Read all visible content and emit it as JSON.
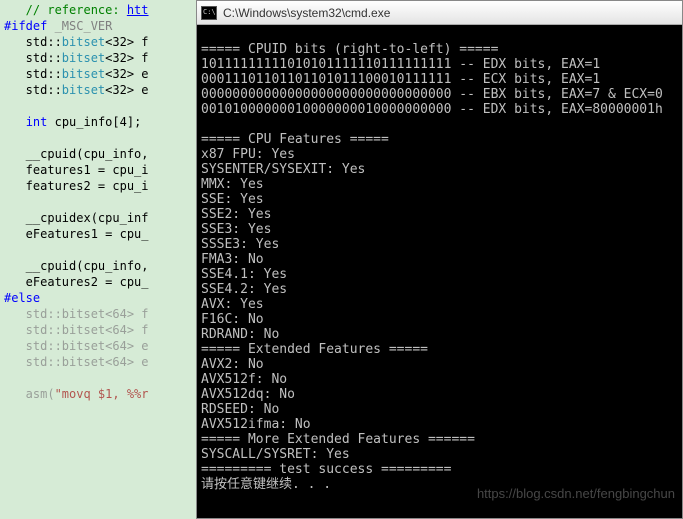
{
  "code": {
    "l1_comment": "   // reference: ",
    "l1_link": "htt",
    "l2": "#ifdef",
    "l2b": " _MSC_VER",
    "l3a": "   std::",
    "l3b": "bitset",
    "l3c": "<32> f",
    "l4a": "   std::",
    "l4b": "bitset",
    "l4c": "<32> f",
    "l5a": "   std::",
    "l5b": "bitset",
    "l5c": "<32> e",
    "l6a": "   std::",
    "l6b": "bitset",
    "l6c": "<32> e",
    "l7": " ",
    "l8a": "   ",
    "l8b": "int",
    "l8c": " cpu_info[4];",
    "l9": " ",
    "l10": "   __cpuid(cpu_info,",
    "l11": "   features1 = cpu_i",
    "l12": "   features2 = cpu_i",
    "l13": " ",
    "l14": "   __cpuidex(cpu_inf",
    "l15": "   eFeatures1 = cpu_",
    "l16": " ",
    "l17": "   __cpuid(cpu_info,",
    "l18": "   eFeatures2 = cpu_",
    "l19": "#else",
    "l20a": "   std::",
    "l20b": "bitset",
    "l20c": "<64> f",
    "l21a": "   std::",
    "l21b": "bitset",
    "l21c": "<64> f",
    "l22a": "   std::",
    "l22b": "bitset",
    "l22c": "<64> e",
    "l23a": "   std::",
    "l23b": "bitset",
    "l23c": "<64> e",
    "l24": " ",
    "l25a": "   asm(",
    "l25b": "\"movq $1, %%r"
  },
  "cmd": {
    "title": "C:\\Windows\\system32\\cmd.exe",
    "lines": [
      "",
      "===== CPUID bits (right-to-left) =====",
      "10111111111010101111110111111111 -- EDX bits, EAX=1",
      "00011101101101101011100010111111 -- ECX bits, EAX=1",
      "00000000000000000000000000000000 -- EBX bits, EAX=7 & ECX=0",
      "00101000000010000000010000000000 -- EDX bits, EAX=80000001h",
      "",
      "===== CPU Features =====",
      "x87 FPU: Yes",
      "SYSENTER/SYSEXIT: Yes",
      "MMX: Yes",
      "SSE: Yes",
      "SSE2: Yes",
      "SSE3: Yes",
      "SSSE3: Yes",
      "FMA3: No",
      "SSE4.1: Yes",
      "SSE4.2: Yes",
      "AVX: Yes",
      "F16C: No",
      "RDRAND: No",
      "===== Extended Features =====",
      "AVX2: No",
      "AVX512f: No",
      "AVX512dq: No",
      "RDSEED: No",
      "AVX512ifma: No",
      "===== More Extended Features ======",
      "SYSCALL/SYSRET: Yes",
      "========= test success =========",
      "请按任意键继续. . ."
    ]
  },
  "watermark": "https://blog.csdn.net/fengbingchun"
}
